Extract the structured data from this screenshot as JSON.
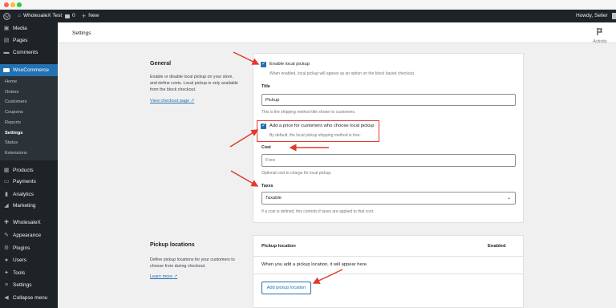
{
  "adminbar": {
    "site_name": "WholesaleX Test",
    "comments_count": "0",
    "new_label": "New",
    "howdy": "Howdy, Seller"
  },
  "sidebar": {
    "top_items": [
      {
        "label": "Media",
        "icon": "media-icon"
      },
      {
        "label": "Pages",
        "icon": "pages-icon"
      },
      {
        "label": "Comments",
        "icon": "comments-icon"
      }
    ],
    "woocommerce": "WooCommerce",
    "sub_items": [
      "Home",
      "Orders",
      "Customers",
      "Coupons",
      "Reports",
      "Settings",
      "Status",
      "Extensions"
    ],
    "bottom_items": [
      {
        "label": "Products",
        "icon": "products-icon"
      },
      {
        "label": "Payments",
        "icon": "payments-icon"
      },
      {
        "label": "Analytics",
        "icon": "analytics-icon"
      },
      {
        "label": "Marketing",
        "icon": "marketing-icon"
      },
      {
        "label": "WholesaleX",
        "icon": "wholesalex-icon"
      },
      {
        "label": "Appearance",
        "icon": "appearance-icon"
      },
      {
        "label": "Plugins",
        "icon": "plugins-icon"
      },
      {
        "label": "Users",
        "icon": "users-icon"
      },
      {
        "label": "Tools",
        "icon": "tools-icon"
      },
      {
        "label": "Settings",
        "icon": "settings-icon"
      },
      {
        "label": "Collapse menu",
        "icon": "collapse-icon"
      }
    ]
  },
  "header": {
    "title": "Settings",
    "activity": "Activity"
  },
  "general": {
    "heading": "General",
    "description": "Enable or disable local pickup on your store, and define costs. Local pickup is only available from the block checkout.",
    "link": "View checkout page",
    "enable_label": "Enable local pickup",
    "enable_help": "When enabled, local pickup will appear as an option on the block based checkout.",
    "title_label": "Title",
    "title_value": "Pickup",
    "title_help": "This is the shipping method title shown to customers.",
    "price_label": "Add a price for customers who choose local pickup",
    "price_help": "By default, the local pickup shipping method is free.",
    "cost_label": "Cost",
    "cost_placeholder": "Free",
    "cost_help": "Optional cost to charge for local pickup.",
    "taxes_label": "Taxes",
    "taxes_value": "Taxable",
    "taxes_help": "If a cost is defined, this controls if taxes are applied to that cost."
  },
  "pickup": {
    "heading": "Pickup locations",
    "description": "Define pickup locations for your customers to choose from during checkout.",
    "link": "Learn more",
    "col_location": "Pickup location",
    "col_enabled": "Enabled",
    "empty": "When you add a pickup location, it will appear here.",
    "add_button": "Add pickup location"
  },
  "colors": {
    "accent": "#2271b1",
    "admin_dark": "#1d2327",
    "annotation_red": "#e03a30"
  }
}
